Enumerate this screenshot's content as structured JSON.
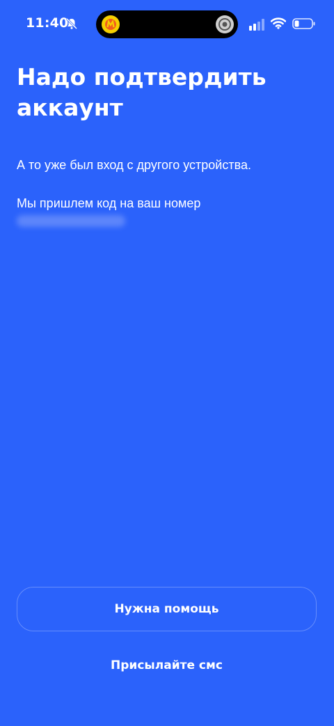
{
  "status_bar": {
    "time": "11:40",
    "icons": [
      "bell-off-icon",
      "app-badge-icon",
      "record-icon",
      "signal-icon",
      "wifi-icon",
      "battery-icon"
    ]
  },
  "main": {
    "title": "Надо подтвердить аккаунт",
    "subtitle": "А то уже был вход с другого устройства.",
    "phone_hint": "Мы пришлем код на ваш номер"
  },
  "actions": {
    "help_label": "Нужна помощь",
    "sms_label": "Присылайте смс"
  },
  "colors": {
    "background": "#2b62fb",
    "text": "#ffffff"
  }
}
